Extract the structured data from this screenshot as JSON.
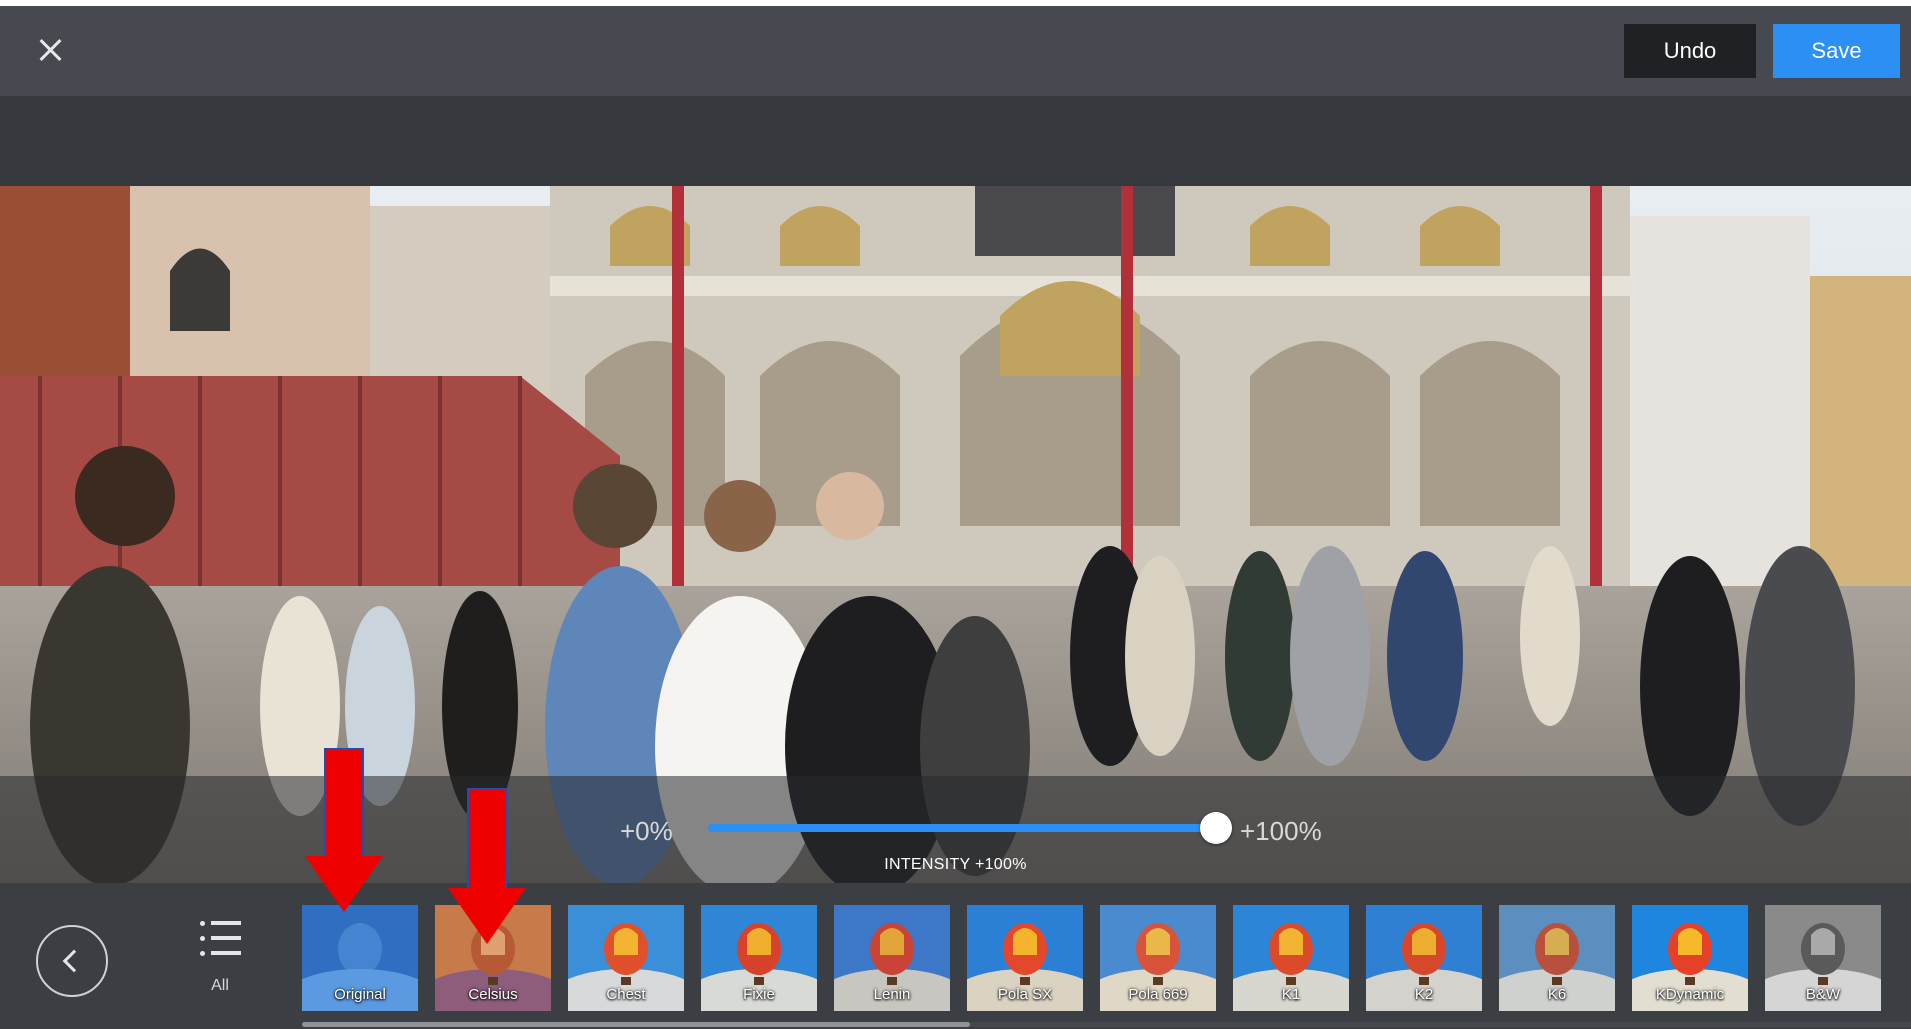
{
  "toolbar": {
    "close_icon": "close-icon",
    "undo_label": "Undo",
    "save_label": "Save",
    "save_color": "#2b8ff3"
  },
  "adjust": {
    "min_label": "+0%",
    "max_label": "+100%",
    "intensity_label": "INTENSITY +100%",
    "value_percent": 100
  },
  "filter_panel": {
    "back_icon": "chevron-left-icon",
    "all_label": "All",
    "selected_filter": "Original",
    "filters": [
      {
        "label": "Original"
      },
      {
        "label": "Celsius"
      },
      {
        "label": "Chest"
      },
      {
        "label": "Fixie"
      },
      {
        "label": "Lenin"
      },
      {
        "label": "Pola SX"
      },
      {
        "label": "Pola 669"
      },
      {
        "label": "K1"
      },
      {
        "label": "K2"
      },
      {
        "label": "K6"
      },
      {
        "label": "KDynamic"
      },
      {
        "label": "B&W"
      }
    ]
  },
  "annotations": {
    "arrow_color": "#e00000"
  }
}
